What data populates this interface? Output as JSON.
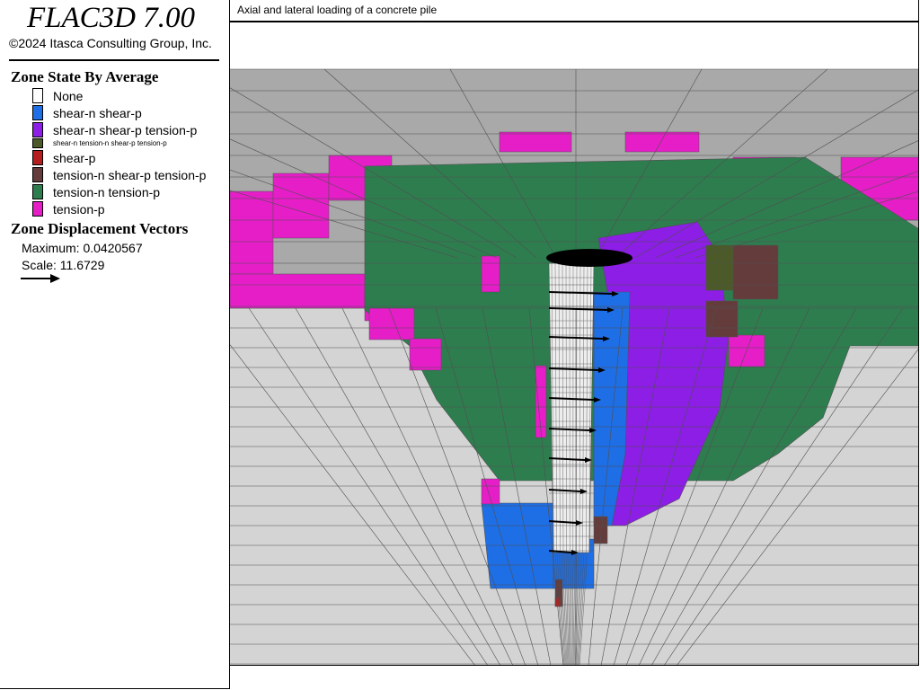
{
  "app": {
    "title": "FLAC3D 7.00",
    "copyright": "©2024 Itasca Consulting Group, Inc."
  },
  "view": {
    "title": "Axial and lateral loading of a concrete pile"
  },
  "legend": {
    "zone_state": {
      "heading": "Zone State By Average",
      "items": [
        {
          "label": "None",
          "color": "#ffffff"
        },
        {
          "label": "shear-n shear-p",
          "color": "#1e6ee6"
        },
        {
          "label": "shear-n shear-p tension-p",
          "color": "#8c1ee6"
        },
        {
          "label": "shear-n tension-n shear-p tension-p",
          "color": "#4b5a28"
        },
        {
          "label": "shear-p",
          "color": "#b41e1e"
        },
        {
          "label": "tension-n shear-p tension-p",
          "color": "#643c3c"
        },
        {
          "label": "tension-n tension-p",
          "color": "#2e7d4f"
        },
        {
          "label": "tension-p",
          "color": "#e61ec8"
        }
      ]
    },
    "displacement": {
      "heading": "Zone Displacement Vectors",
      "maximum": "Maximum: 0.0420567",
      "scale": "Scale: 11.6729"
    }
  },
  "model_colors": {
    "background": "#ffffff",
    "top_surface": "#a9a9a9",
    "near_face": "#d4d4d4",
    "pile": "#ededed",
    "grid_line": "#505050",
    "vectors": "#000000"
  },
  "icons": {
    "vector_scale": "right-arrow-icon"
  }
}
